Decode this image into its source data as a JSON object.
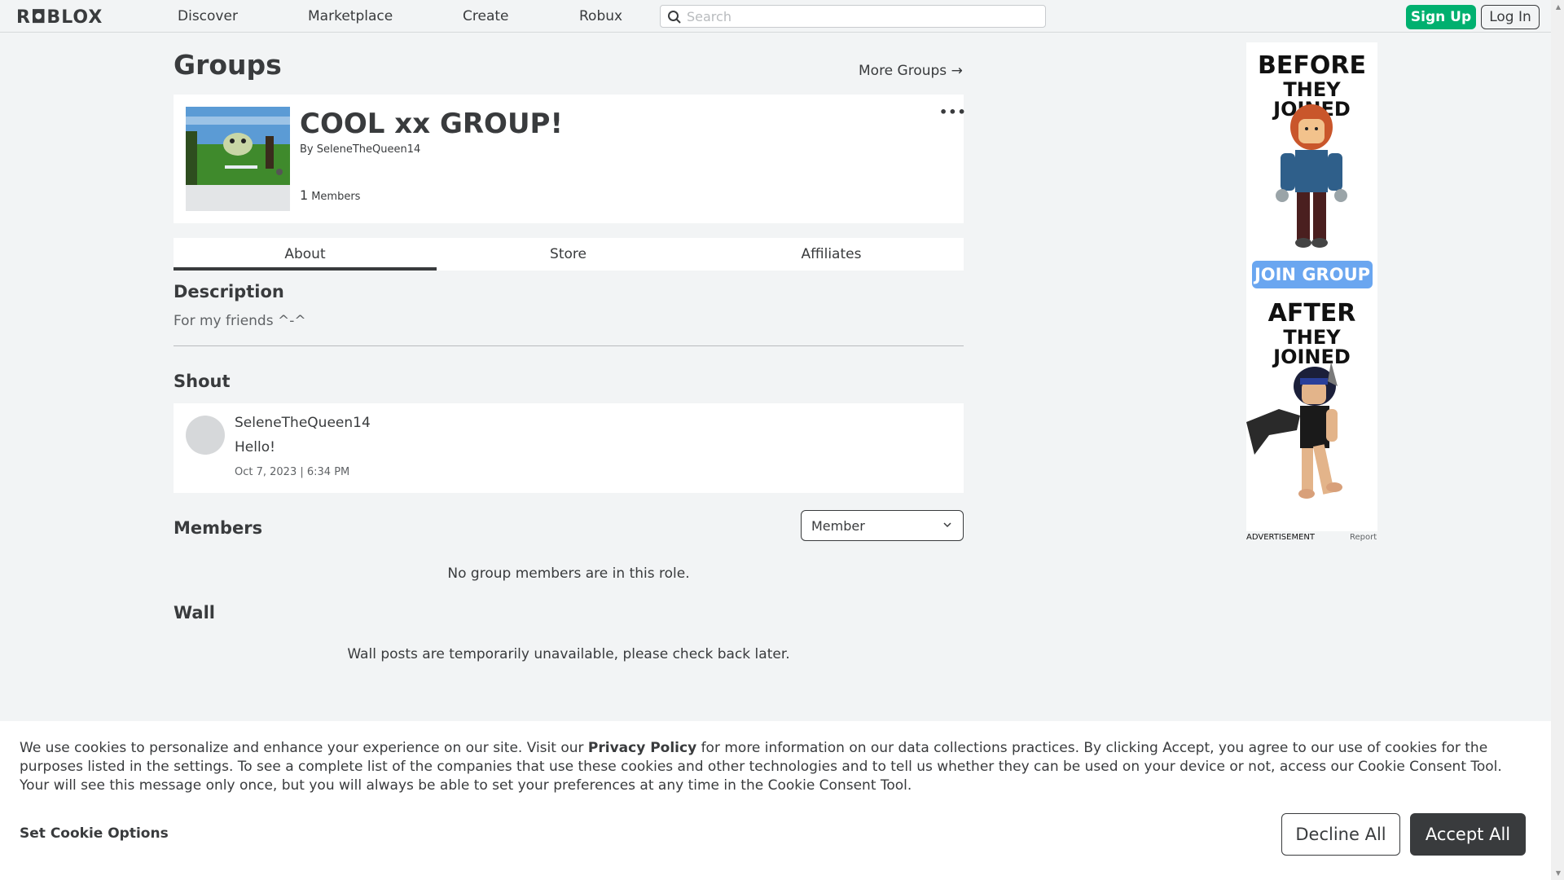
{
  "nav": {
    "logo": "R◘BLOX",
    "links": [
      "Discover",
      "Marketplace",
      "Create",
      "Robux"
    ],
    "search_placeholder": "Search",
    "signup": "Sign Up",
    "login": "Log In"
  },
  "page": {
    "title": "Groups",
    "more_groups": "More Groups →"
  },
  "group": {
    "name": "COOL xx GROUP!",
    "by_label": "By",
    "owner": "SeleneTheQueen14",
    "member_count": "1",
    "members_label": "Members",
    "more_menu": "•••"
  },
  "tabs": [
    "About",
    "Store",
    "Affiliates"
  ],
  "description": {
    "title": "Description",
    "text": "For my friends ^-^"
  },
  "shout": {
    "title": "Shout",
    "user": "SeleneTheQueen14",
    "message": "Hello!",
    "time": "Oct 7, 2023 | 6:34 PM"
  },
  "members": {
    "title": "Members",
    "role_selected": "Member",
    "empty": "No group members are in this role."
  },
  "wall": {
    "title": "Wall",
    "empty": "Wall posts are temporarily unavailable, please check back later."
  },
  "ad": {
    "top_line1": "BEFORE",
    "top_line2": "THEY JOINED",
    "join": "JOIN GROUP",
    "bottom_line1": "AFTER",
    "bottom_line2": "THEY JOINED",
    "label": "ADVERTISEMENT",
    "report": "Report"
  },
  "cookie": {
    "text_before": "We use cookies to personalize and enhance your experience on our site. Visit our ",
    "privacy_link": "Privacy Policy",
    "text_after": " for more information on our data collections practices. By clicking Accept, you agree to our use of cookies for the purposes listed in the settings. To see a complete list of the companies that use these cookies and other technologies and to tell us whether they can be used on your device or not, access our Cookie Consent Tool. Your will see this message only once, but you will always be able to set your preferences at any time in the Cookie Consent Tool.",
    "options": "Set Cookie Options",
    "decline": "Decline All",
    "accept": "Accept All"
  },
  "colors": {
    "signup_green": "#00b06f",
    "accept_dark": "#393b3d",
    "ad_join_blue": "#6aa6f0"
  }
}
